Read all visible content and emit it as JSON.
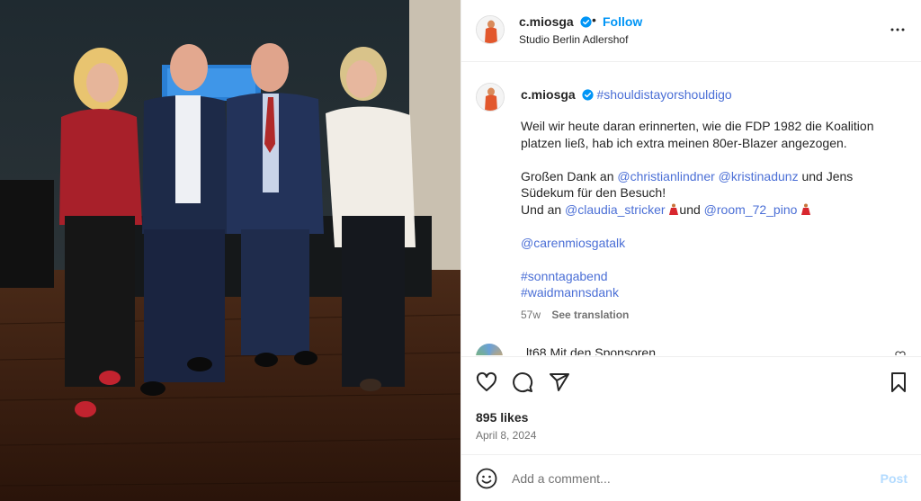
{
  "post": {
    "username": "c.miosga",
    "follow_label": "Follow",
    "location": "Studio Berlin Adlershof",
    "separator": "•"
  },
  "caption": {
    "username": "c.miosga",
    "hashtag_title": "#shouldistayorshouldigo",
    "para1": "Weil wir heute daran erinnerten, wie die FDP 1982 die Koalition platzen ließ, hab ich extra meinen 80er-Blazer angezogen.",
    "thanks_prefix": "Großen Dank an",
    "mention1": "@christianlindner",
    "mention2": "@kristinadunz",
    "thanks_suffix": "und Jens Südekum für den Besuch!",
    "und_an": "Und an",
    "mention3": "@claudia_stricker",
    "und": "und",
    "mention4": "@room_72_pino",
    "mention5": "@carenmiosgatalk",
    "hashtag1": "#sonntagabend",
    "hashtag2": "#waidmannsdank",
    "age": "57w",
    "see_translation": "See translation"
  },
  "comment_preview": {
    "text": "lt68 Mit den Sponsoren..."
  },
  "stats": {
    "likes": "895 likes",
    "date": "April 8, 2024"
  },
  "comment_box": {
    "placeholder": "Add a comment...",
    "post_label": "Post"
  },
  "icons": {
    "verified": "verified-badge-icon",
    "more": "more-options-icon",
    "like": "heart-icon",
    "comment": "comment-icon",
    "share": "share-icon",
    "save": "bookmark-icon",
    "emoji": "emoji-icon"
  },
  "colors": {
    "accent": "#0095f6",
    "link": "#4b6fd6",
    "muted": "#737373",
    "post_disabled": "#b3dbff"
  }
}
